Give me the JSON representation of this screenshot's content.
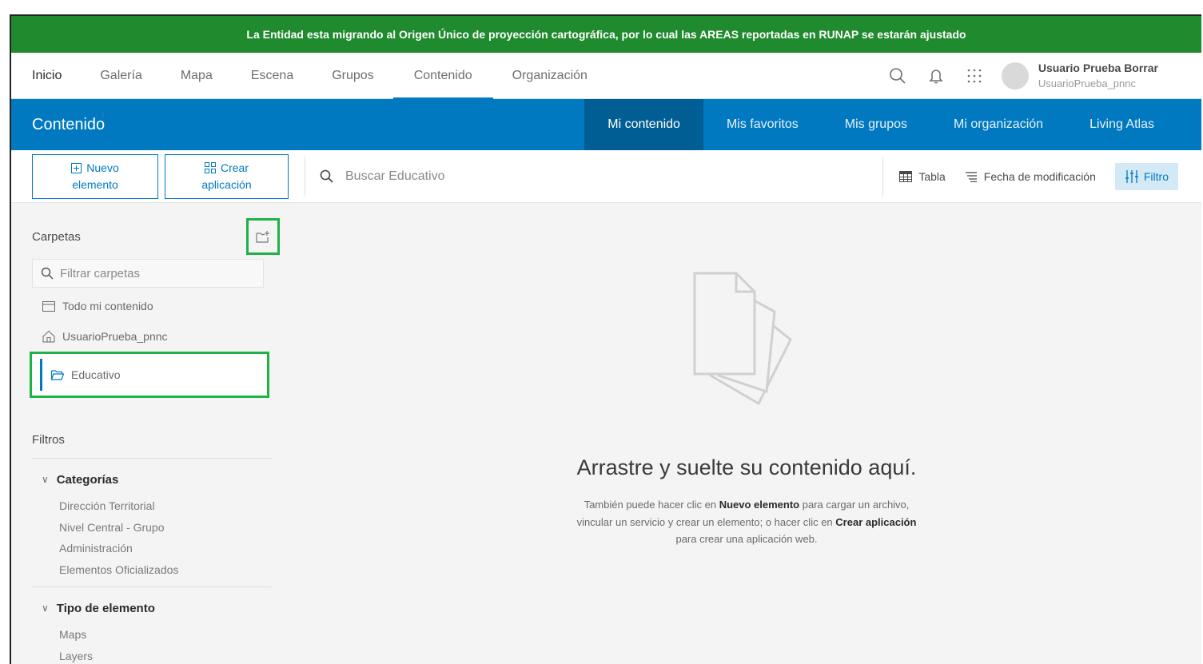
{
  "banner": {
    "text": "La Entidad esta migrando al Origen Único de proyección cartográfica, por lo cual las AREAS reportadas en RUNAP se estarán ajustado"
  },
  "topnav": {
    "items": [
      {
        "label": "Inicio"
      },
      {
        "label": "Galería"
      },
      {
        "label": "Mapa"
      },
      {
        "label": "Escena"
      },
      {
        "label": "Grupos"
      },
      {
        "label": "Contenido"
      },
      {
        "label": "Organización"
      }
    ],
    "active_index": 5,
    "icons": [
      "search-icon",
      "bell-icon",
      "app-launcher-icon"
    ],
    "user": {
      "name": "Usuario Prueba Borrar",
      "handle": "UsuarioPrueba_pnnc"
    }
  },
  "header": {
    "title": "Contenido",
    "tabs": [
      {
        "label": "Mi contenido"
      },
      {
        "label": "Mis favoritos"
      },
      {
        "label": "Mis grupos"
      },
      {
        "label": "Mi organización"
      },
      {
        "label": "Living Atlas"
      }
    ],
    "active_tab": 0
  },
  "toolbar": {
    "new_item": {
      "line1": "Nuevo",
      "line2": "elemento"
    },
    "create_app": {
      "line1": "Crear",
      "line2": "aplicación"
    },
    "search_placeholder": "Buscar Educativo",
    "view_label": "Tabla",
    "sort_label": "Fecha de modificación",
    "filter_label": "Filtro"
  },
  "sidebar": {
    "folders_title": "Carpetas",
    "filter_placeholder": "Filtrar carpetas",
    "folders": [
      {
        "label": "Todo mi contenido",
        "icon": "folder-all-icon"
      },
      {
        "label": "UsuarioPrueba_pnnc",
        "icon": "home-folder-icon"
      },
      {
        "label": "Educativo",
        "icon": "folder-open-icon",
        "selected": true
      }
    ],
    "filters_title": "Filtros",
    "groups": [
      {
        "title": "Categorías",
        "items": [
          "Dirección Territorial",
          "Nivel Central - Grupo",
          "Administración",
          "Elementos Oficializados"
        ]
      },
      {
        "title": "Tipo de elemento",
        "items": [
          "Maps",
          "Layers"
        ]
      }
    ]
  },
  "empty": {
    "title": "Arrastre y suelte su contenido aquí.",
    "desc_part1": "También puede hacer clic en ",
    "desc_bold1": "Nuevo elemento",
    "desc_part2": " para cargar un archivo,",
    "desc_part3": "vincular un servicio y crear un elemento; o hacer clic en ",
    "desc_bold2": "Crear aplicación",
    "desc_part4": "para crear una aplicación web."
  },
  "colors": {
    "banner": "#1f8a2e",
    "brand_blue": "#0079c1",
    "active_tab": "#005e95",
    "highlight_green": "#1fb14a"
  }
}
